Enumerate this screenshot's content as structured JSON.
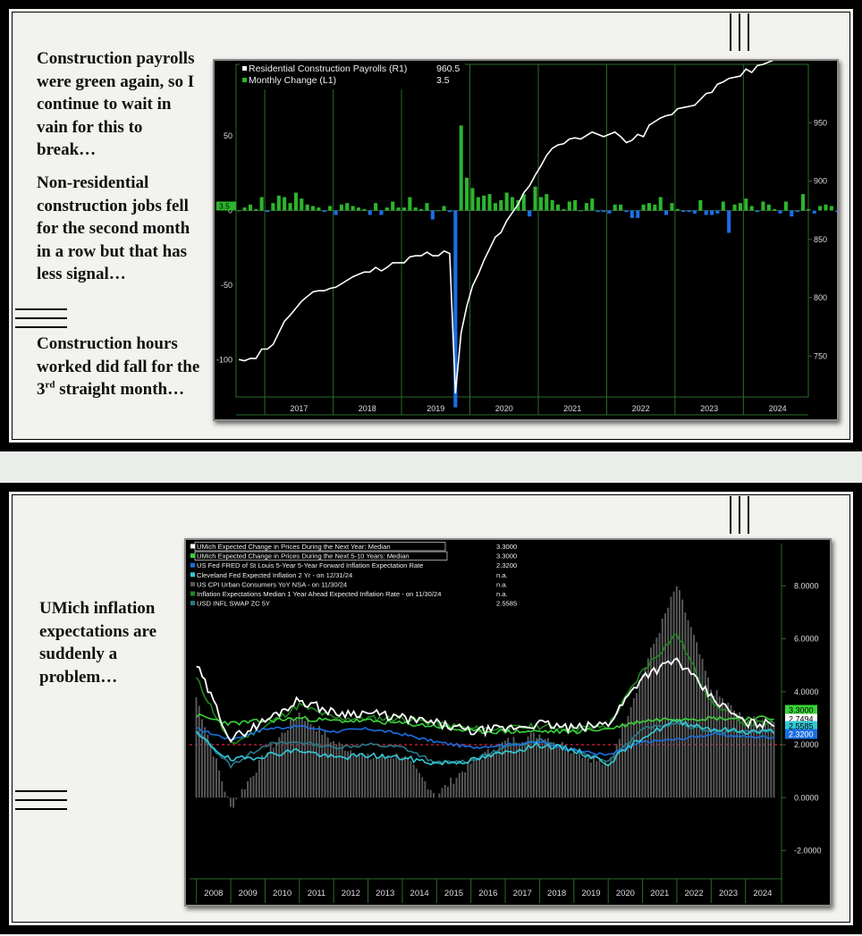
{
  "slide1": {
    "notes": [
      "Construction payrolls were green again, so I continue to wait in vain for this to break…",
      "Non-residential construction jobs fell for the second month in a row but that has less signal…"
    ],
    "note3": {
      "pre": "Construction hours worked did fall for the 3",
      "sup": "rd",
      "post": " straight month…"
    }
  },
  "slide2": {
    "note": "UMich inflation expectations are suddenly a problem…"
  },
  "chart_data": [
    {
      "type": "bar+line",
      "x_labels": [
        "2017",
        "2018",
        "2019",
        "2020",
        "2021",
        "2022",
        "2023",
        "2024"
      ],
      "legend": [
        {
          "name": "Residential Construction Payrolls (R1)",
          "value": "960.5",
          "color": "#ffffff"
        },
        {
          "name": "Monthly Change (L1)",
          "value": "3.5",
          "color": "#2db52d"
        }
      ],
      "left_axis": {
        "ticks": [
          "50",
          "0",
          "-50",
          "-100"
        ],
        "values": [
          50,
          0,
          -50,
          -100
        ],
        "range": [
          -125,
          98
        ]
      },
      "right_axis": {
        "ticks": [
          "950",
          "900",
          "850",
          "800",
          "750"
        ],
        "values": [
          950,
          900,
          850,
          800,
          750
        ],
        "range": [
          715,
          1000
        ]
      },
      "x_start": 2016.58,
      "series_line": {
        "name": "Residential Construction Payrolls",
        "last_label": "960.5",
        "values": [
          747,
          746,
          748,
          748,
          756,
          756,
          760,
          770,
          780,
          785,
          791,
          797,
          801,
          805,
          806,
          806,
          808,
          809,
          812,
          815,
          818,
          820,
          822,
          822,
          826,
          823,
          826,
          830,
          830,
          830,
          835,
          836,
          836,
          839,
          836,
          836,
          840,
          838,
          718,
          770,
          793,
          810,
          820,
          832,
          842,
          852,
          856,
          866,
          873,
          880,
          890,
          896,
          905,
          913,
          922,
          928,
          931,
          932,
          936,
          937,
          936,
          939,
          942,
          940,
          938,
          940,
          942,
          938,
          933,
          935,
          940,
          938,
          948,
          951,
          954,
          956,
          957,
          962,
          963,
          964,
          965,
          970,
          975,
          976,
          983,
          985,
          988,
          989,
          990,
          996,
          993,
          999,
          1000,
          1002,
          1004,
          1005,
          1009,
          1010,
          1012,
          1013,
          1012,
          1018,
          1022,
          1022,
          1022,
          1022,
          1024,
          1024
        ]
      },
      "series_bars": {
        "name": "Monthly Change",
        "last_label": "3.5",
        "values": [
          0,
          2,
          4,
          1,
          9,
          -1,
          5,
          10,
          9,
          5,
          12,
          8,
          4,
          3,
          2,
          -1,
          3,
          -3,
          4,
          5,
          3,
          2,
          1,
          -3,
          5,
          -3,
          2,
          6,
          2,
          2,
          9,
          2,
          1,
          5,
          -6,
          0,
          3,
          -1,
          -132,
          57,
          22,
          15,
          9,
          10,
          11,
          5,
          7,
          12,
          9,
          7,
          11,
          -4,
          16,
          9,
          11,
          7,
          4,
          1,
          6,
          7,
          0,
          5,
          8,
          -1,
          -1,
          -2,
          4,
          4,
          -1,
          -5,
          -5,
          4,
          5,
          4,
          9,
          -3,
          5,
          1,
          -1,
          -1,
          -2,
          7,
          -3,
          -3,
          -2,
          6,
          -15,
          4,
          5,
          8,
          3,
          -1,
          6,
          4,
          1,
          -2,
          6,
          -4,
          -1,
          11,
          1,
          -2,
          3,
          4,
          3,
          -1,
          5,
          3.5
        ]
      }
    },
    {
      "type": "line+bar",
      "x_labels": [
        "2008",
        "2009",
        "2010",
        "2011",
        "2012",
        "2013",
        "2014",
        "2015",
        "2016",
        "2017",
        "2018",
        "2019",
        "2020",
        "2021",
        "2022",
        "2023",
        "2024"
      ],
      "legend": [
        {
          "name": "UMich Expected Change in Prices During the Next Year: Median",
          "value": "3.3000",
          "color": "#ffffff"
        },
        {
          "name": "UMich Expected Change in Prices During the Next 5-10 Years: Median",
          "value": "3.3000",
          "color": "#39d339"
        },
        {
          "name": "US Fed FRED of St Louis 5-Year 5-Year Forward Inflation Expectation Rate",
          "value": "2.3200",
          "color": "#1a6fe0"
        },
        {
          "name": "Cleveland Fed Expected Inflation 2 Yr -  on 12/31/24",
          "value": "n.a.",
          "color": "#33c9d6"
        },
        {
          "name": "US CPI Urban Consumers YoY NSA -  on 11/30/24",
          "value": "n.a.",
          "color": "#555555"
        },
        {
          "name": "Inflation Expectations Median 1 Year Ahead Expected Inflation Rate -  on 11/30/24",
          "value": "n.a.",
          "color": "#1f8a1f"
        },
        {
          "name": "USD INFL SWAP ZC 5Y",
          "value": "2.5585",
          "color": "#2a7a8a"
        }
      ],
      "right_axis": {
        "ticks": [
          "8.0000",
          "6.0000",
          "4.0000",
          "2.0000",
          "0.0000",
          "-2.0000"
        ],
        "values": [
          8,
          6,
          4,
          2,
          0,
          -2
        ],
        "range": [
          -3.2,
          9.6
        ]
      },
      "ref_line": 2.0,
      "value_labels": [
        "3.3000",
        "2.7494",
        "2.5585",
        "2.3200"
      ],
      "x_start": 2007.8,
      "x_end": 2025.05,
      "annual": {
        "years": [
          2008,
          2009,
          2010,
          2011,
          2012,
          2013,
          2014,
          2015,
          2016,
          2017,
          2018,
          2019,
          2020,
          2021,
          2022,
          2023,
          2024
        ],
        "umich_1y": [
          5.0,
          2.2,
          2.9,
          3.7,
          3.2,
          3.2,
          3.0,
          2.8,
          2.5,
          2.6,
          2.8,
          2.6,
          2.8,
          4.6,
          5.2,
          3.8,
          2.8
        ],
        "umich_5y": [
          3.1,
          2.8,
          2.9,
          3.0,
          2.9,
          2.9,
          2.8,
          2.7,
          2.5,
          2.5,
          2.5,
          2.5,
          2.6,
          2.9,
          3.0,
          3.0,
          3.0
        ],
        "fed_5y5y": [
          2.6,
          2.2,
          2.6,
          2.7,
          2.5,
          2.6,
          2.4,
          2.1,
          1.9,
          2.0,
          2.1,
          1.8,
          1.6,
          2.1,
          2.2,
          2.4,
          2.3
        ],
        "cleveland_2y": [
          2.4,
          1.4,
          1.6,
          1.8,
          1.5,
          1.6,
          1.5,
          1.3,
          1.4,
          1.7,
          2.0,
          1.8,
          1.3,
          2.3,
          2.9,
          2.6,
          2.5
        ],
        "cpi_yoy": [
          3.8,
          -0.4,
          1.6,
          3.2,
          2.1,
          1.5,
          1.6,
          0.1,
          1.3,
          2.1,
          2.4,
          1.8,
          1.2,
          4.7,
          8.0,
          4.1,
          2.9
        ],
        "infl_exp_1y": [
          4.5,
          2.0,
          2.7,
          3.5,
          3.0,
          3.0,
          3.0,
          2.8,
          2.6,
          2.6,
          2.7,
          2.6,
          2.7,
          4.8,
          6.2,
          3.6,
          2.8
        ],
        "swap_5y": [
          2.5,
          1.2,
          2.0,
          2.1,
          1.9,
          2.0,
          1.9,
          1.3,
          1.4,
          1.9,
          2.2,
          1.8,
          1.4,
          2.6,
          2.8,
          2.5,
          2.5
        ]
      }
    }
  ]
}
